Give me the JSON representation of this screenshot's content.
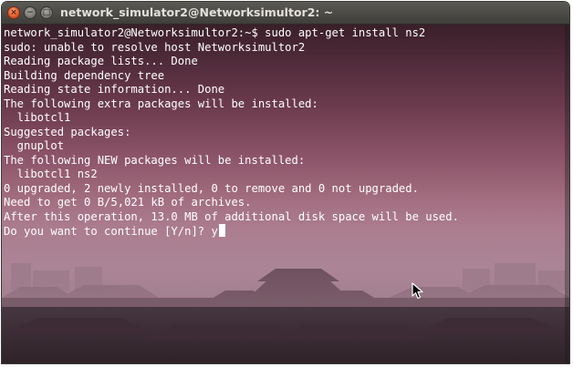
{
  "window": {
    "title": "network_simulator2@Networksimultor2: ~",
    "buttons": {
      "close_glyph": "×",
      "minimize_glyph": "−",
      "maximize_glyph": "□"
    }
  },
  "terminal": {
    "lines": [
      "network_simulator2@Networksimultor2:~$ sudo apt-get install ns2",
      "sudo: unable to resolve host Networksimultor2",
      "Reading package lists... Done",
      "Building dependency tree",
      "Reading state information... Done",
      "The following extra packages will be installed:",
      "  libotcl1",
      "Suggested packages:",
      "  gnuplot",
      "The following NEW packages will be installed:",
      "  libotcl1 ns2",
      "0 upgraded, 2 newly installed, 0 to remove and 0 not upgraded.",
      "Need to get 0 B/5,021 kB of archives.",
      "After this operation, 13.0 MB of additional disk space will be used.",
      "Do you want to continue [Y/n]? y"
    ]
  },
  "icons": {
    "pointer": "mouse-pointer-icon",
    "close": "close-icon",
    "minimize": "minimize-icon",
    "maximize": "maximize-icon"
  }
}
